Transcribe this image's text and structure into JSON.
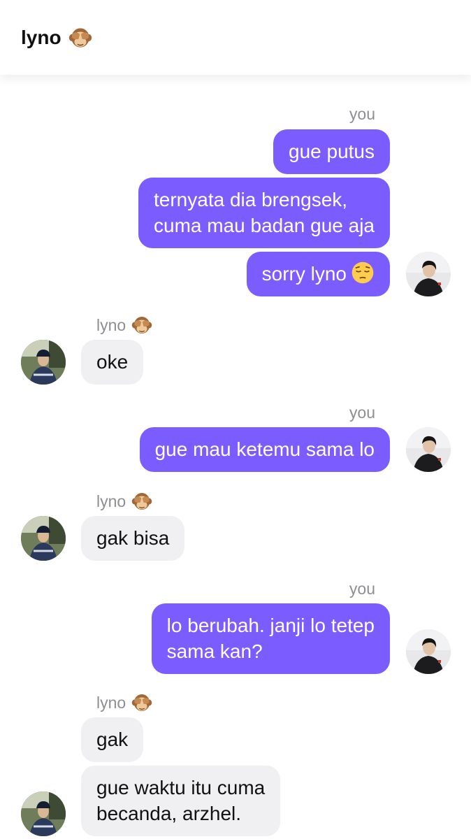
{
  "header": {
    "title": "lyno",
    "title_icon": "see-no-evil-monkey-icon"
  },
  "labels": {
    "you": "you",
    "lyno": "lyno"
  },
  "colors": {
    "outgoing": "#7b5cff",
    "incoming": "#f0f0f3",
    "sender": "#8e8e93"
  },
  "messages": {
    "m1": "gue putus",
    "m2_line1": "ternyata dia brengsek,",
    "m2_line2": "cuma mau badan gue aja",
    "m3": "sorry lyno",
    "m4": "oke",
    "m5": "gue mau ketemu sama lo",
    "m6": "gak bisa",
    "m7_line1": "lo berubah. janji lo tetep",
    "m7_line2": "sama kan?",
    "m8": "gak",
    "m9_line1": "gue waktu itu cuma",
    "m9_line2": "becanda, arzhel."
  }
}
